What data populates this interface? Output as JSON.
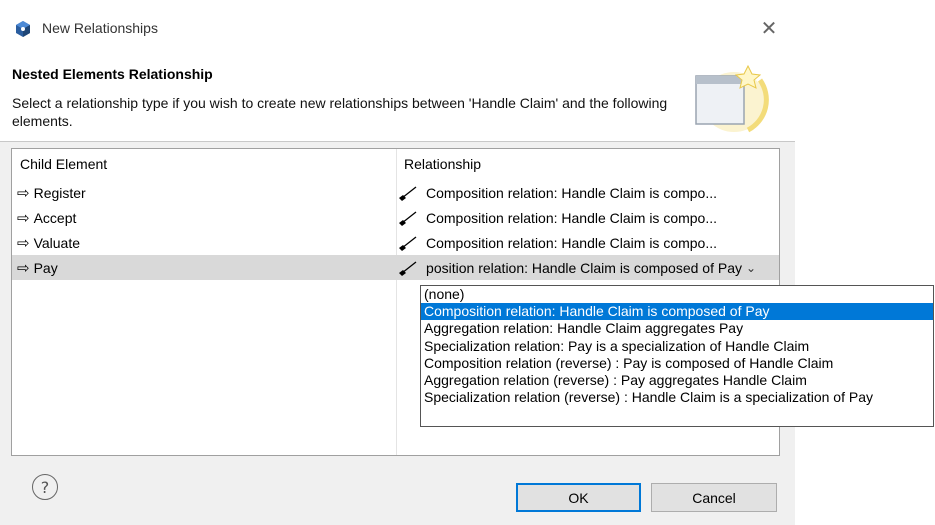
{
  "window": {
    "title": "New Relationships",
    "close_glyph": "✕"
  },
  "header": {
    "title": "Nested Elements Relationship",
    "description": "Select a relationship type if you wish to create new relationships between 'Handle Claim' and the following elements."
  },
  "table": {
    "columns": [
      "Child Element",
      "Relationship"
    ],
    "rows": [
      {
        "child": "Register",
        "relationship": "Composition relation: Handle Claim is compo..."
      },
      {
        "child": "Accept",
        "relationship": "Composition relation: Handle Claim is compo..."
      },
      {
        "child": "Valuate",
        "relationship": "Composition relation: Handle Claim is compo..."
      },
      {
        "child": "Pay",
        "relationship": "Composition relation: Handle Claim is composed of Pay",
        "selected": true
      }
    ]
  },
  "dropdown": {
    "options": [
      "(none)",
      "Composition relation: Handle Claim is composed of Pay",
      "Aggregation relation: Handle Claim aggregates Pay",
      "Specialization relation: Pay is a specialization of Handle Claim",
      "Composition relation (reverse) : Pay is composed of Handle Claim",
      "Aggregation relation (reverse) : Pay aggregates Handle Claim",
      "Specialization relation (reverse) : Handle Claim is a specialization of Pay"
    ],
    "selected_index": 1
  },
  "footer": {
    "help_glyph": "?",
    "ok_label": "OK",
    "cancel_label": "Cancel"
  },
  "icons": {
    "app": "app-icon",
    "child_arrow": "right-arrow-icon",
    "relation": "composition-relation-icon",
    "dropdown": "chevron-down-icon",
    "help": "help-icon",
    "wizard": "wizard-banner-icon"
  },
  "colors": {
    "selection": "#0078d7",
    "row_highlight": "#d9d9d9",
    "dialog_bg": "#f0f0f0"
  }
}
